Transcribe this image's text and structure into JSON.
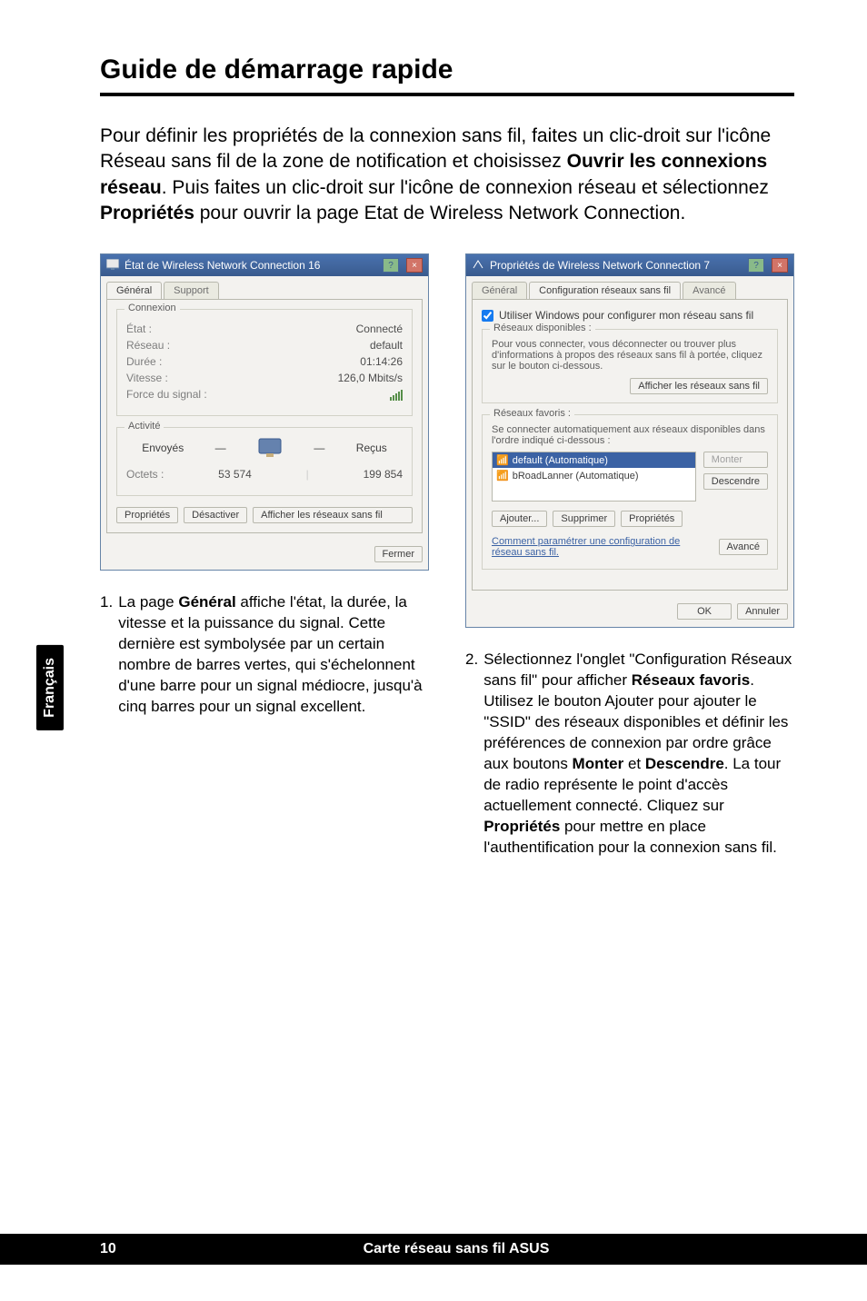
{
  "heading": "Guide de démarrage rapide",
  "intro": {
    "p1a": "Pour définir les propriétés de la connexion sans fil, faites un clic-droit sur l'icône Réseau sans fil de la zone de notification et choisissez ",
    "b1": "Ouvrir les connexions réseau",
    "p1b": ". Puis faites un clic-droit sur l'icône de connexion réseau et sélectionnez ",
    "b2": "Propriétés",
    "p1c": " pour ouvrir la page Etat de Wireless Network Connection."
  },
  "left_dialog": {
    "title": "État de Wireless Network Connection 16",
    "tabs": {
      "active": "Général",
      "inactive": "Support"
    },
    "group1_legend": "Connexion",
    "rows": {
      "etat_lbl": "État :",
      "etat_val": "Connecté",
      "reseau_lbl": "Réseau :",
      "reseau_val": "default",
      "duree_lbl": "Durée :",
      "duree_val": "01:14:26",
      "vitesse_lbl": "Vitesse :",
      "vitesse_val": "126,0 Mbits/s",
      "force_lbl": "Force du signal :"
    },
    "group2_legend": "Activité",
    "activity": {
      "envoyes_lbl": "Envoyés",
      "recus_lbl": "Reçus",
      "octets_lbl": "Octets :",
      "env_val": "53 574",
      "rec_val": "199 854"
    },
    "buttons": {
      "proprietes": "Propriétés",
      "desactiver": "Désactiver",
      "afficher": "Afficher les réseaux sans fil",
      "fermer": "Fermer"
    }
  },
  "right_dialog": {
    "title": "Propriétés de Wireless Network Connection 7",
    "tabs": {
      "t1": "Général",
      "t2": "Configuration réseaux sans fil",
      "t3": "Avancé"
    },
    "checkbox_label": "Utiliser Windows pour configurer mon réseau sans fil",
    "group1_legend": "Réseaux disponibles :",
    "group1_text": "Pour vous connecter, vous déconnecter ou trouver plus d'informations à propos des réseaux sans fil à portée, cliquez sur le bouton ci-dessous.",
    "btn_afficher": "Afficher les réseaux sans fil",
    "group2_legend": "Réseaux favoris :",
    "group2_text": "Se connecter automatiquement aux réseaux disponibles dans l'ordre indiqué ci-dessous :",
    "items": {
      "i1": "default (Automatique)",
      "i2": "bRoadLanner (Automatique)"
    },
    "side": {
      "monter": "Monter",
      "descendre": "Descendre"
    },
    "row_btns": {
      "ajouter": "Ajouter...",
      "supprimer": "Supprimer",
      "proprietes": "Propriétés"
    },
    "advanced_text": "Comment paramétrer une configuration de réseau sans fil.",
    "btn_avance": "Avancé",
    "ok": "OK",
    "annuler": "Annuler"
  },
  "step1": {
    "num": "1.",
    "a": "La page ",
    "b1": "Général",
    "b": " affiche l'état, la durée, la vitesse et la puissance du signal. Cette dernière est symbolysée par un certain nombre de barres vertes, qui s'échelonnent d'une barre pour un signal médiocre, jusqu'à cinq barres pour un signal excellent."
  },
  "step2": {
    "num": "2.",
    "a": "Sélectionnez l'onglet \"Configuration Réseaux sans fil\" pour afficher ",
    "b1": "Réseaux favoris",
    "b": ". Utilisez le bouton Ajouter pour ajouter le \"SSID\" des réseaux disponibles et définir les préférences de connexion par ordre grâce aux boutons ",
    "b2": "Monter",
    "c": " et ",
    "b3": "Descendre",
    "d": ". La tour de radio représente le point d'accès actuellement connecté. Cliquez sur ",
    "b4": "Propriétés",
    "e": " pour mettre en place l'authentification pour la connexion sans fil."
  },
  "sidetab": "Français",
  "footer": {
    "page": "10",
    "title": "Carte réseau sans fil ASUS"
  }
}
